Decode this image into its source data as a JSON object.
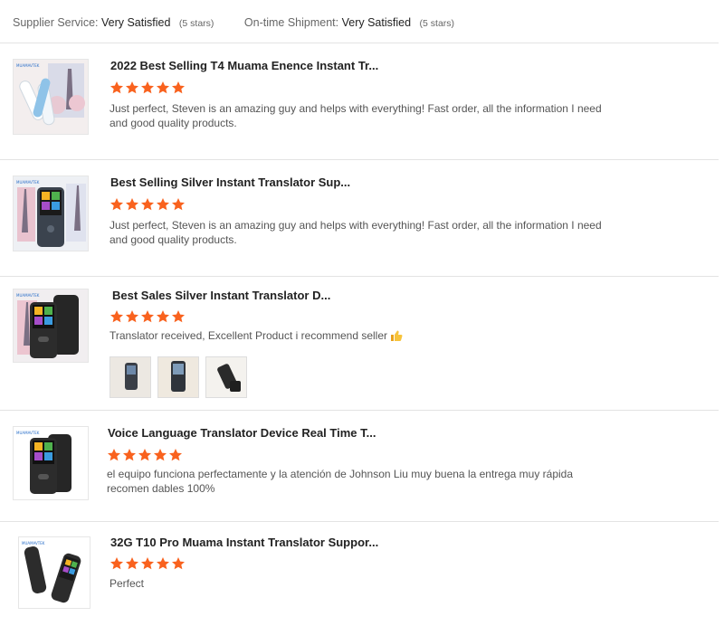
{
  "summary": {
    "supplier_label": "Supplier Service:",
    "supplier_value": "Very Satisfied",
    "supplier_stars": "(5 stars)",
    "shipment_label": "On-time Shipment:",
    "shipment_value": "Very Satisfied",
    "shipment_stars": "(5 stars)"
  },
  "colors": {
    "star": "#f9621e",
    "separator": "#e3e3e3",
    "title": "#222222",
    "text": "#555555"
  },
  "reviews": [
    {
      "title": "2022 Best Selling T4 Muama Enence Instant Tr...",
      "rating": 5,
      "comment": "Just perfect, Steven is an amazing guy and helps with everything! Fast order, all the information  I need and good quality products.",
      "thumb_brand": "MUAMAVTEK",
      "thumb_icon": "white-pen-translator-eiffel-image"
    },
    {
      "title": "Best Selling Silver Instant Translator Sup...",
      "rating": 5,
      "comment": "Just perfect, Steven is an amazing guy and helps with everything! Fast order, all the information  I need and good quality products.",
      "thumb_brand": "MUAMAVTEK",
      "thumb_icon": "silver-translator-eiffel-image"
    },
    {
      "title": "Best Sales Silver Instant Translator D...",
      "rating": 5,
      "comment": "Translator received,  Excellent Product i recommend seller",
      "comment_emoji": "thumbs-up-emoji",
      "thumb_brand": "MUAMAVTEK",
      "thumb_icon": "black-translator-eiffel-image",
      "photos": [
        "translator-photo-1",
        "translator-photo-2",
        "translator-photo-3"
      ]
    },
    {
      "title": "Voice Language Translator Device Real Time T...",
      "rating": 5,
      "comment": "el equipo funciona perfectamente y la atención de Johnson Liu muy buena la entrega muy rápida recomen dables 100%",
      "thumb_brand": "MUAMAVTEK",
      "thumb_icon": "black-translator-image"
    },
    {
      "title": "32G T10 Pro Muama Instant Translator Suppor...",
      "rating": 5,
      "comment": "Perfect",
      "thumb_brand": "MUAMAVTEK",
      "thumb_icon": "two-translators-image"
    }
  ]
}
